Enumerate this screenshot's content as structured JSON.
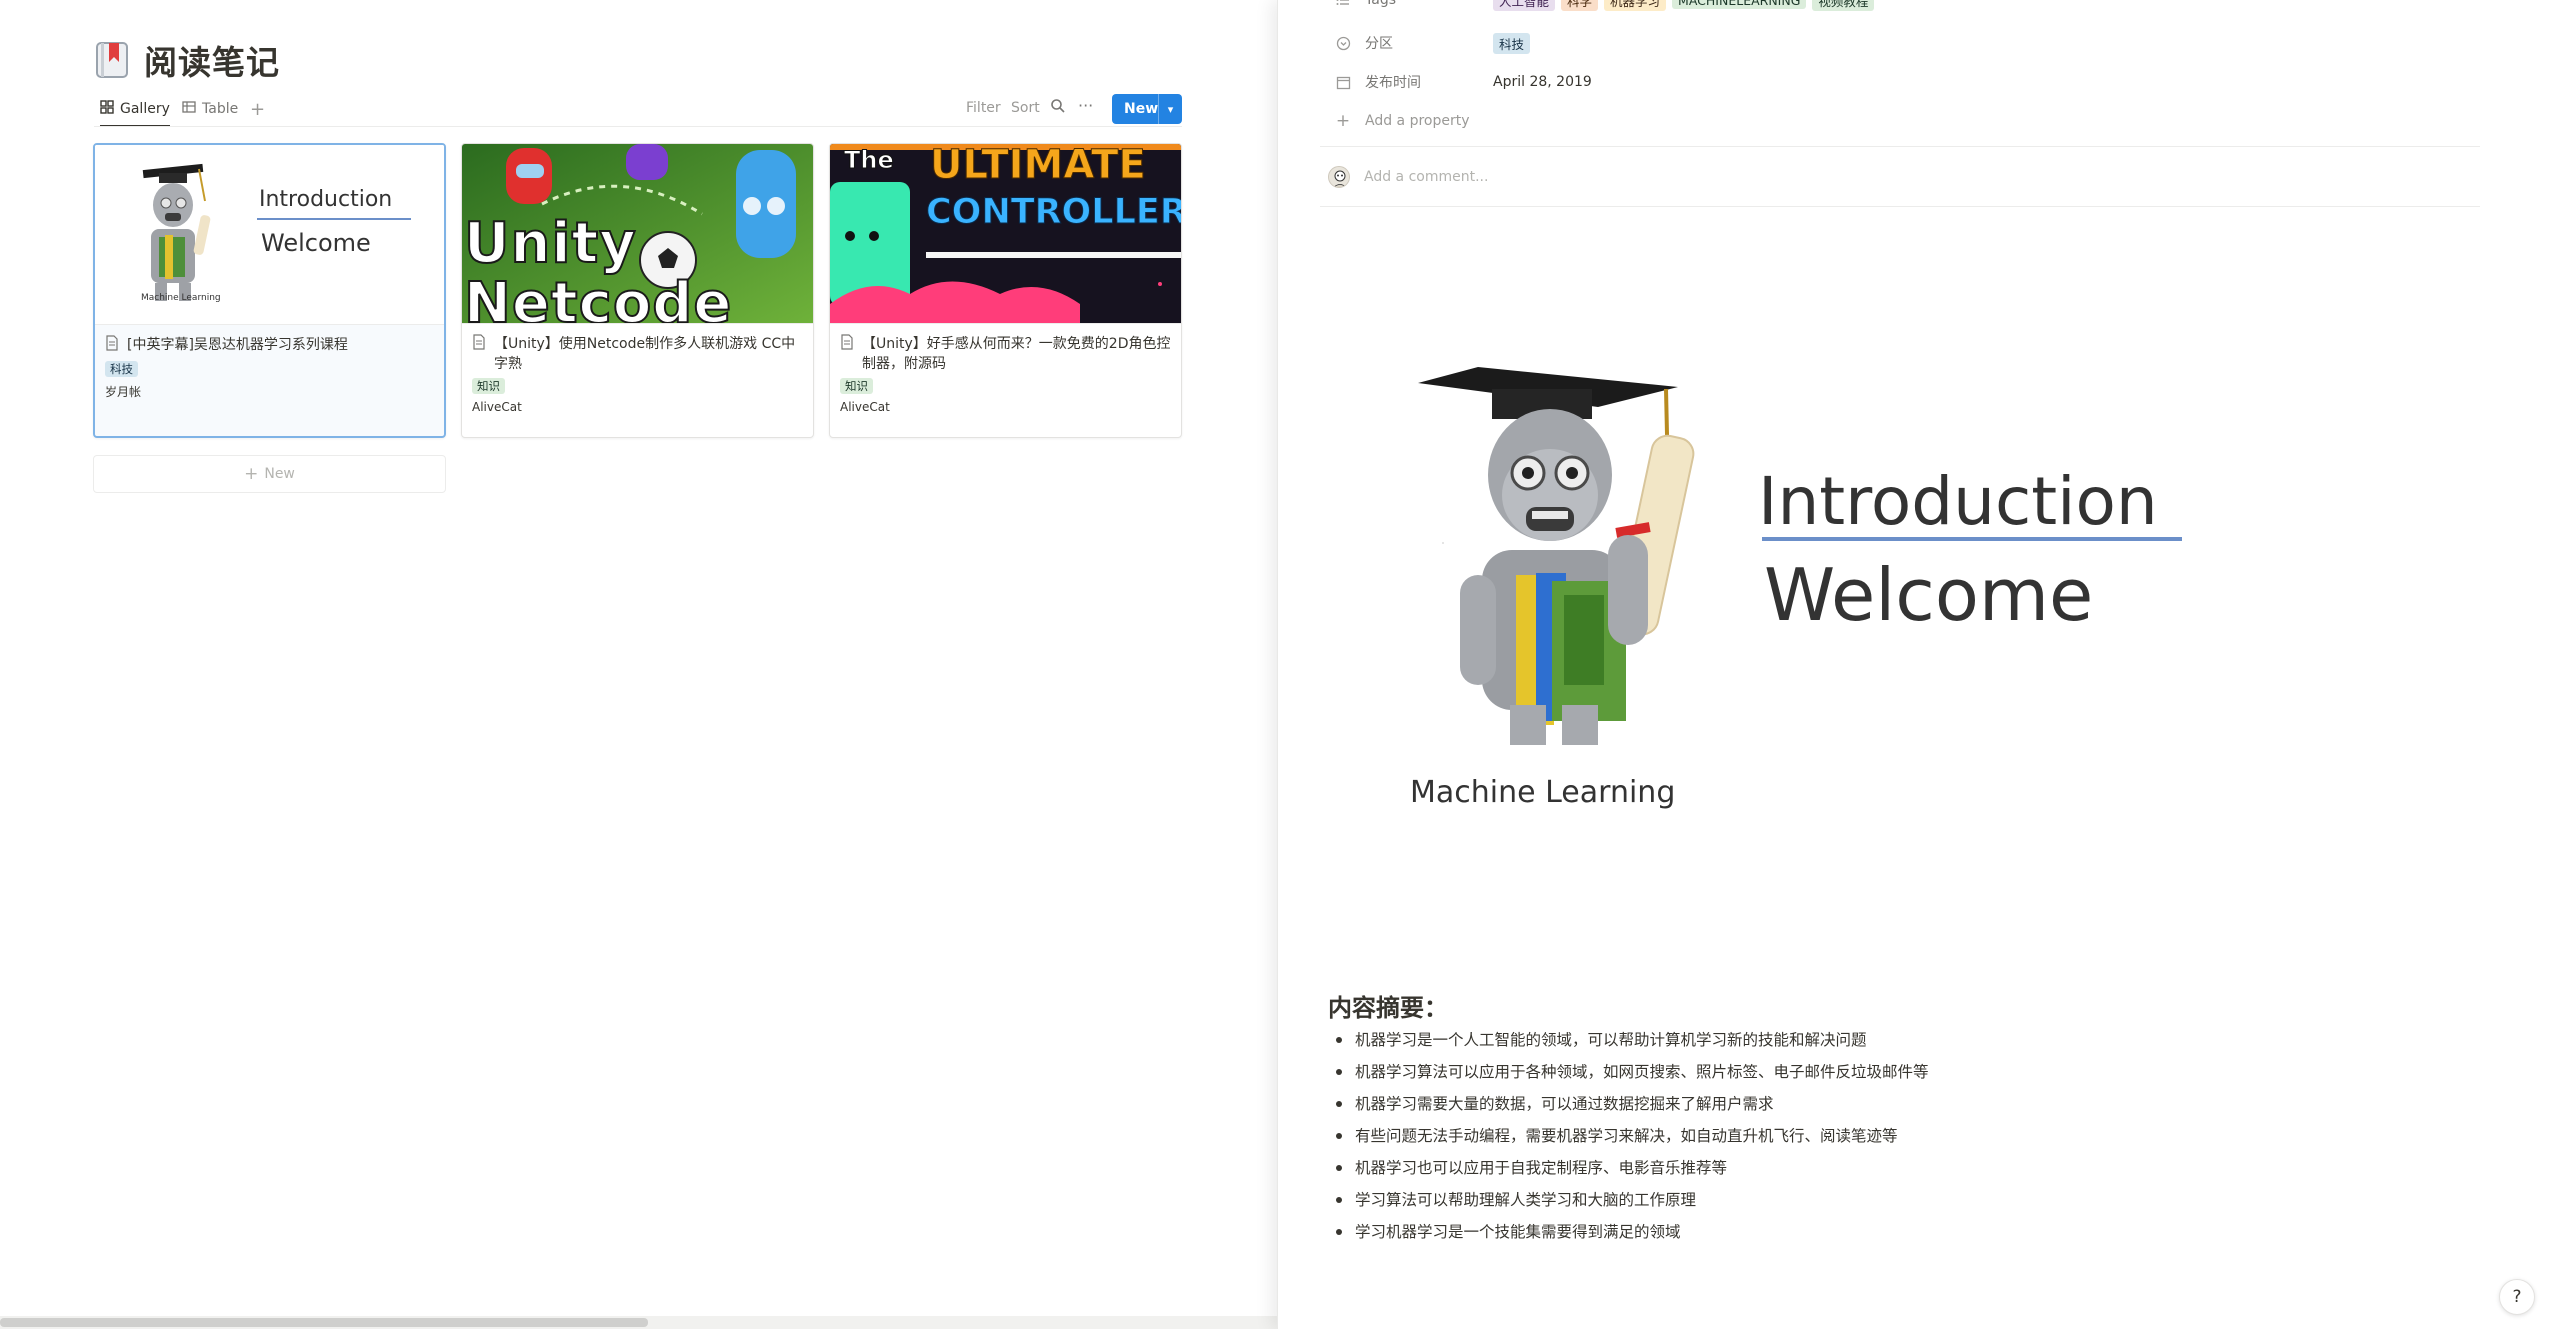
{
  "database": {
    "title": "阅读笔记",
    "views": [
      {
        "label": "Gallery",
        "icon": "gallery-icon"
      },
      {
        "label": "Table",
        "icon": "table-icon"
      }
    ],
    "toolbar": {
      "filter": "Filter",
      "sort": "Sort",
      "more": "···",
      "new_label": "New"
    },
    "cards": [
      {
        "cover_heading": "Introduction",
        "cover_sub": "Welcome",
        "cover_caption": "Machine Learning",
        "title": "[中英字幕]吴恩达机器学习系列课程",
        "tag": "科技",
        "author": "岁月帐"
      },
      {
        "cover_text": "Unity Netcode",
        "title": "【Unity】使用Netcode制作多人联机游戏 CC中字熟",
        "tag": "知识",
        "author": "AliveCat"
      },
      {
        "cover_text_1": "The",
        "cover_text_2": "ULTIMATE",
        "cover_text_3": "CONTROLLER",
        "title": "【Unity】好手感从何而来？一款免费的2D角色控制器，附源码",
        "tag": "知识",
        "author": "AliveCat"
      }
    ],
    "add_new": "New"
  },
  "peek": {
    "tags_row": {
      "label": "Tags",
      "values": [
        "人工智能",
        "科学",
        "机器学习",
        "MACHINELEARNING",
        "视频教程"
      ]
    },
    "category_row": {
      "label": "分区",
      "value": "科技"
    },
    "date_row": {
      "label": "发布时间",
      "value": "April 28, 2019"
    },
    "add_property": "Add a property",
    "comment_placeholder": "Add a comment...",
    "hero": {
      "heading": "Introduction",
      "sub": "Welcome",
      "caption": "Machine Learning"
    },
    "summary_title": "内容摘要：",
    "summary_items": [
      "机器学习是一个人工智能的领域，可以帮助计算机学习新的技能和解决问题",
      "机器学习算法可以应用于各种领域，如网页搜索、照片标签、电子邮件反垃圾邮件等",
      "机器学习需要大量的数据，可以通过数据挖掘来了解用户需求",
      "有些问题无法手动编程，需要机器学习来解决，如自动直升机飞行、阅读笔迹等",
      "机器学习也可以应用于自我定制程序、电影音乐推荐等",
      "学习算法可以帮助理解人类学习和大脑的工作原理",
      "学习机器学习是一个技能集需要得到满足的领域"
    ],
    "help": "?"
  },
  "colors": {
    "accent": "#2383e2",
    "selected_border": "#7fb3e6"
  }
}
